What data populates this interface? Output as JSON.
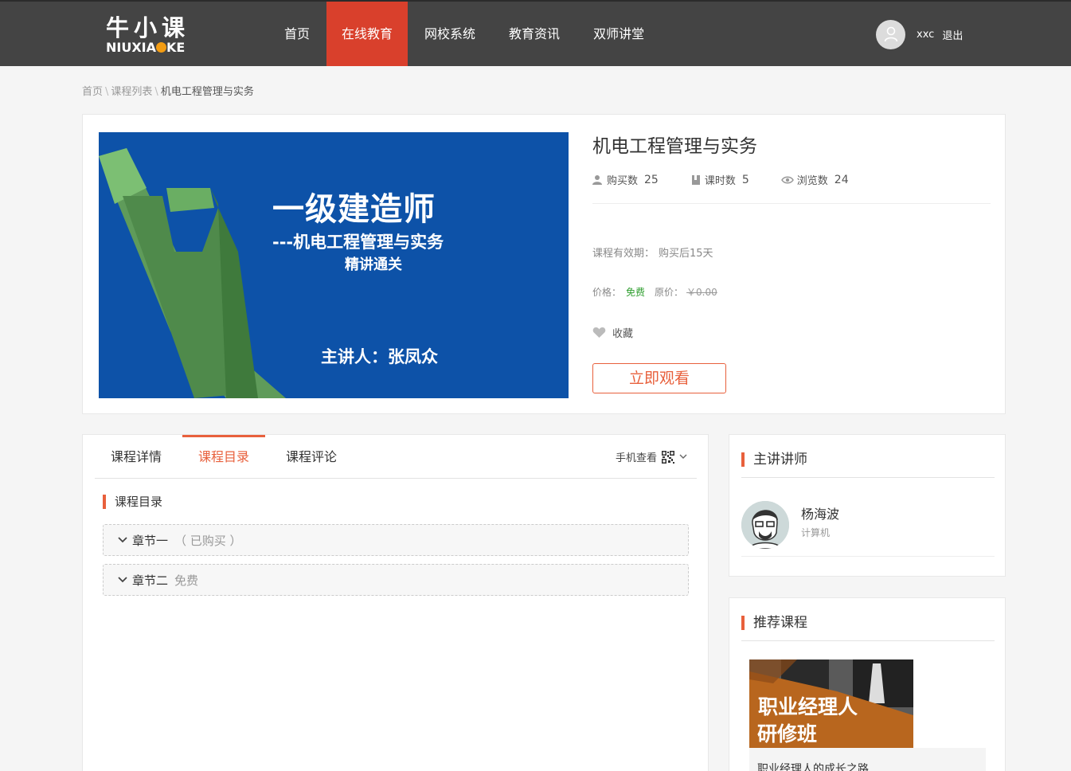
{
  "header": {
    "logo_cn": "牛小课",
    "logo_en_a": "NIUXIA",
    "logo_en_b": "KE",
    "nav": [
      "首页",
      "在线教育",
      "网校系统",
      "教育资讯",
      "双师讲堂"
    ],
    "active_nav": "在线教育",
    "username": "xxc",
    "logout": "退出"
  },
  "breadcrumb": {
    "home": "首页",
    "list": "课程列表",
    "current": "机电工程管理与实务",
    "separator": "\\"
  },
  "course": {
    "cover": {
      "line1": "一级建造师",
      "line2": "---机电工程管理与实务",
      "line3": "精讲通关",
      "line4": "主讲人：张凤众"
    },
    "title": "机电工程管理与实务",
    "stats": {
      "buy_label": "购买数",
      "buy_value": "25",
      "lesson_label": "课时数",
      "lesson_value": "5",
      "view_label": "浏览数",
      "view_value": "24"
    },
    "validity_label": "课程有效期：",
    "validity_value": "购买后15天",
    "price_label": "价格：",
    "price_value": "免费",
    "orig_label": "原价：",
    "orig_value": "￥0.00",
    "favorite": "收藏",
    "watch_button": "立即观看"
  },
  "tabs": {
    "detail": "课程详情",
    "catalog": "课程目录",
    "comments": "课程评论",
    "mobile": "手机查看"
  },
  "catalog": {
    "title": "课程目录",
    "chapters": [
      {
        "name": "章节一",
        "tag": "（ 已购买 ）"
      },
      {
        "name": "章节二",
        "tag": "免费"
      }
    ]
  },
  "teacher_panel": {
    "title": "主讲讲师",
    "name": "杨海波",
    "dept": "计算机"
  },
  "recommend_panel": {
    "title": "推荐课程",
    "image_line1": "职业经理人",
    "image_line2": "研修班",
    "caption": "职业经理人的成长之路"
  },
  "colors": {
    "accent": "#e8603c",
    "header_bg": "#444444",
    "active_nav": "#d9402c",
    "free": "#2e9e2e",
    "cover_bg": "#0d52a8"
  },
  "icons": [
    "user-avatar-icon",
    "buyers-icon",
    "lessons-icon",
    "views-icon",
    "heart-icon",
    "qr-code-icon",
    "chevron-down-icon"
  ]
}
